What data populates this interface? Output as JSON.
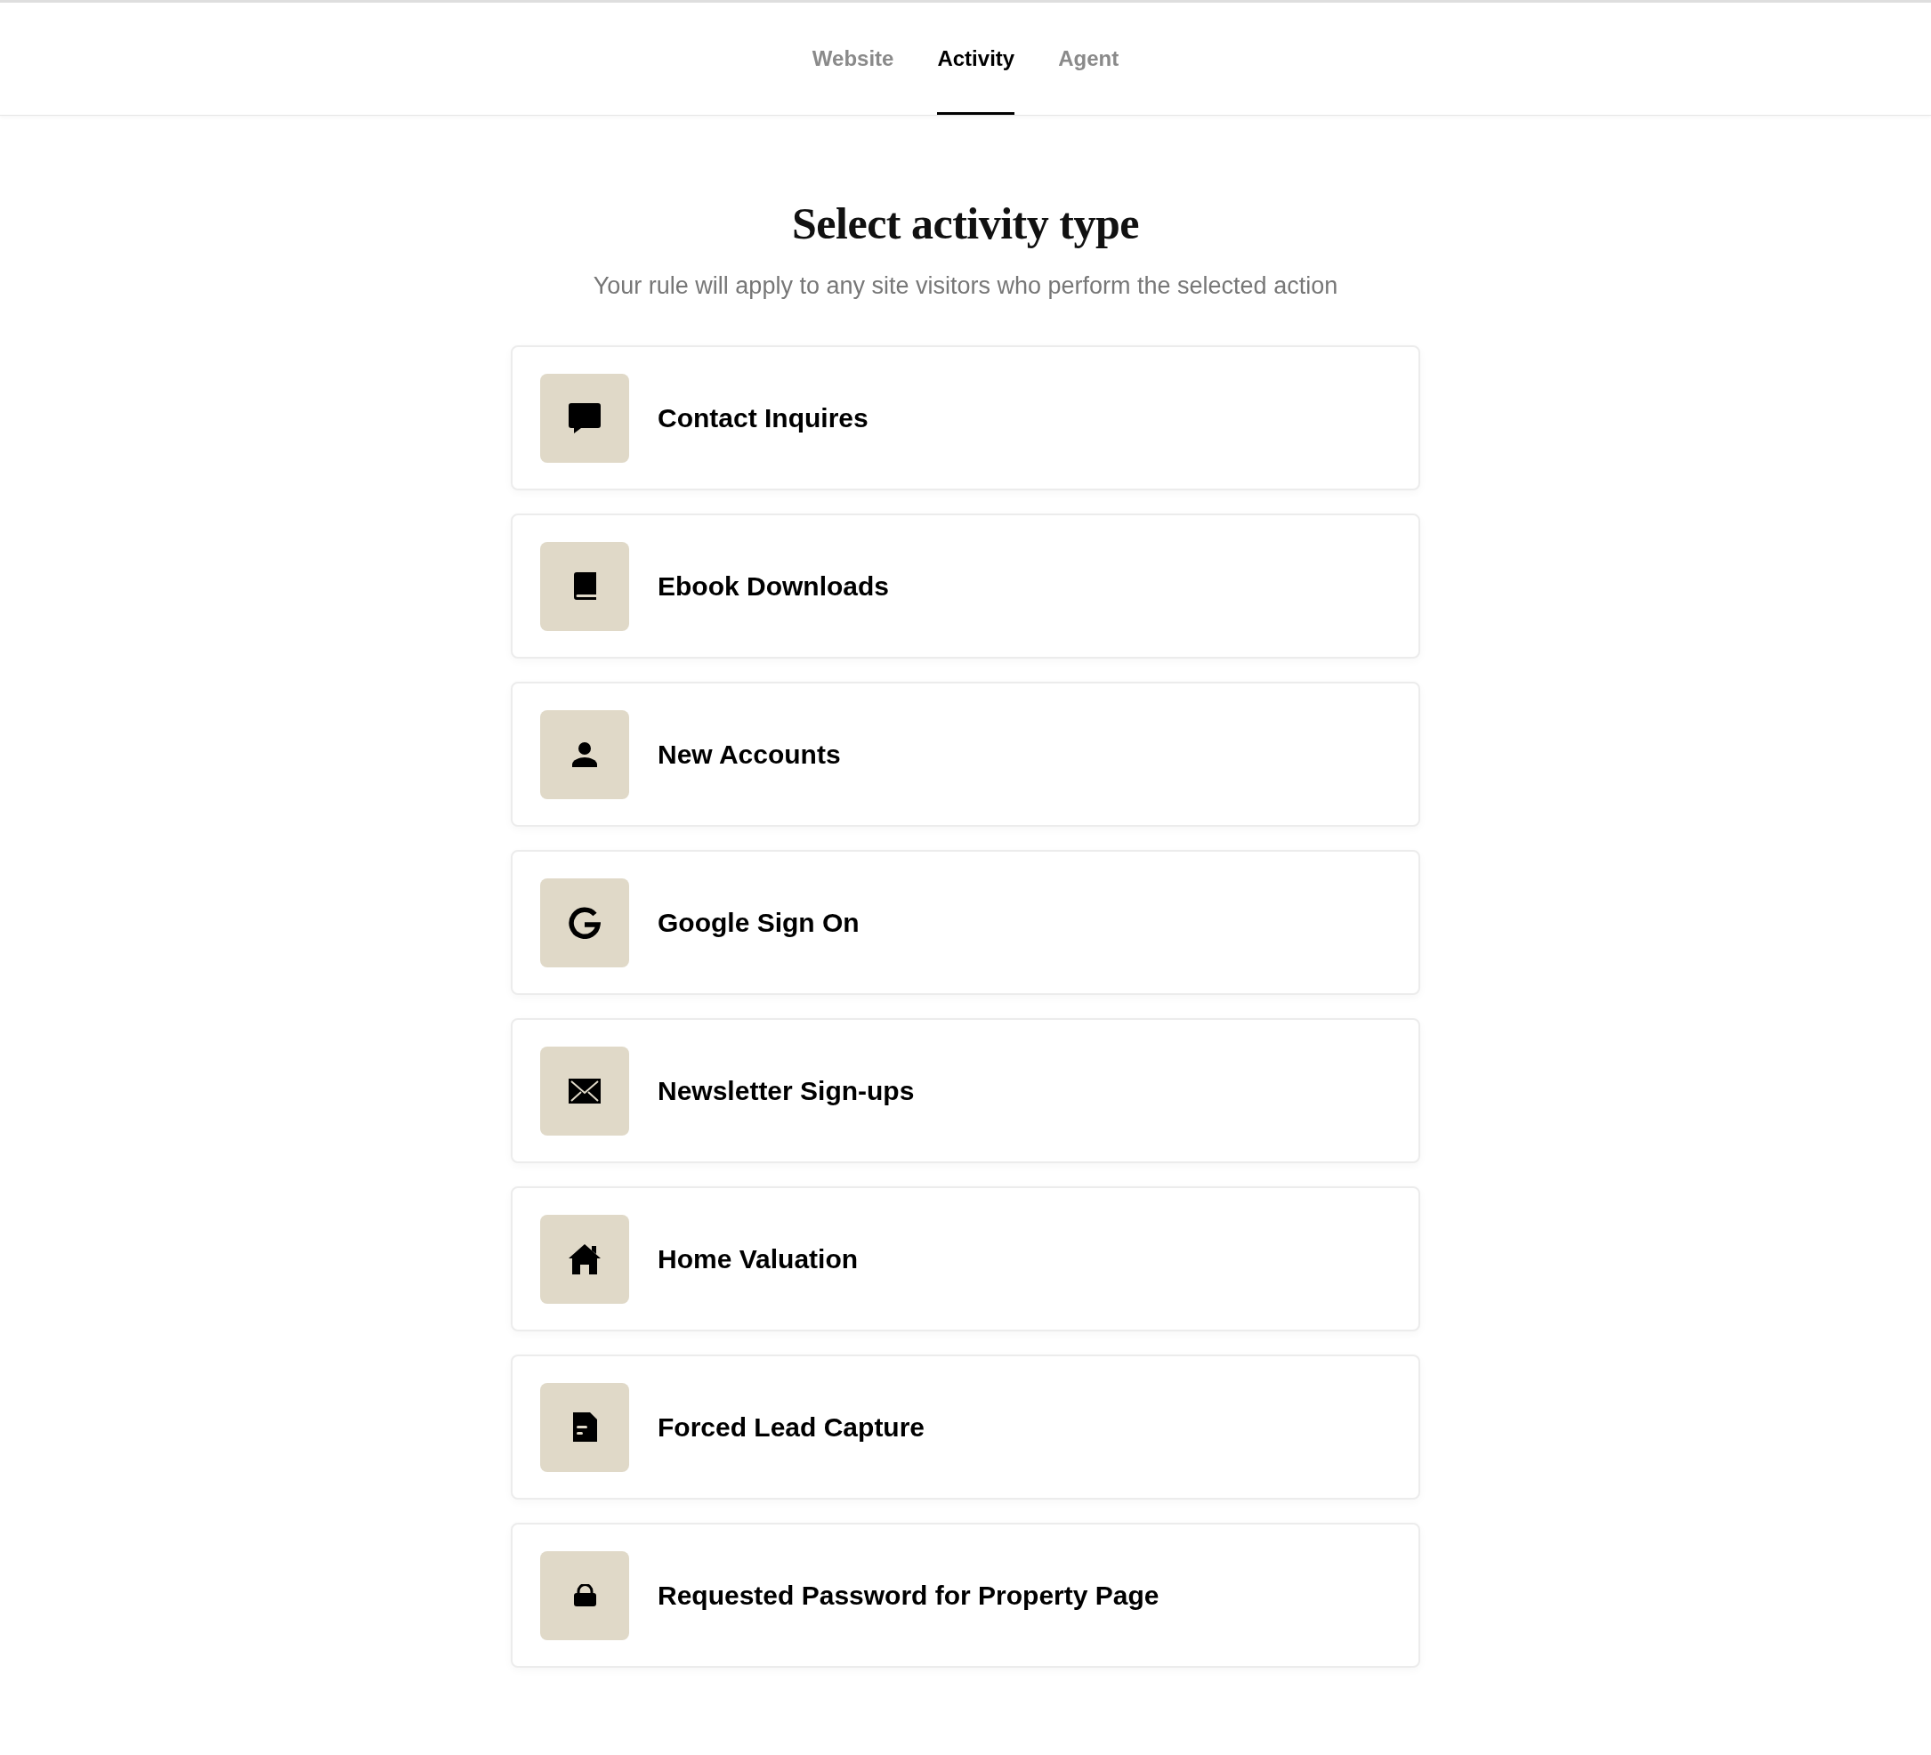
{
  "tabs": [
    {
      "label": "Website",
      "selected": false
    },
    {
      "label": "Activity",
      "selected": true
    },
    {
      "label": "Agent",
      "selected": false
    }
  ],
  "heading": "Select activity type",
  "subheading": "Your rule will apply to any site visitors who perform the selected action",
  "activity_types": [
    {
      "label": "Contact Inquires",
      "kind": "chat"
    },
    {
      "label": "Ebook Downloads",
      "kind": "book"
    },
    {
      "label": "New Accounts",
      "kind": "person"
    },
    {
      "label": "Google Sign On",
      "kind": "google"
    },
    {
      "label": "Newsletter Sign-ups",
      "kind": "envelope"
    },
    {
      "label": "Home Valuation",
      "kind": "house"
    },
    {
      "label": "Forced Lead Capture",
      "kind": "document"
    },
    {
      "label": "Requested Password for Property Page",
      "kind": "lock"
    }
  ]
}
